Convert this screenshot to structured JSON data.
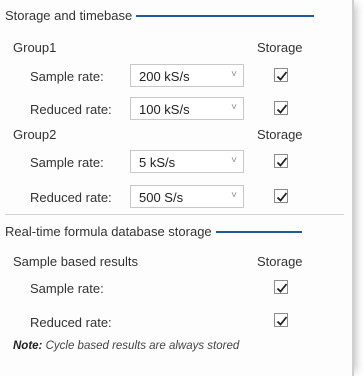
{
  "storage_section": {
    "title": "Storage and timebase",
    "groups": [
      {
        "label": "Group1",
        "storage_header": "Storage",
        "sample_label": "Sample rate:",
        "sample_value": "200 kS/s",
        "sample_checked": true,
        "reduced_label": "Reduced rate:",
        "reduced_value": "100 kS/s",
        "reduced_checked": true
      },
      {
        "label": "Group2",
        "storage_header": "Storage",
        "sample_label": "Sample rate:",
        "sample_value": "5 kS/s",
        "sample_checked": true,
        "reduced_label": "Reduced rate:",
        "reduced_value": "500 S/s",
        "reduced_checked": true
      }
    ]
  },
  "formula_section": {
    "title": "Real-time formula database storage",
    "subheading": "Sample based results",
    "storage_header": "Storage",
    "sample_label": "Sample rate:",
    "sample_checked": true,
    "reduced_label": "Reduced rate:",
    "reduced_checked": true,
    "note_label": "Note:",
    "note_text": "Cycle based results are always stored"
  },
  "colors": {
    "accent_rule": "#1f5a9e"
  },
  "icons": {
    "dropdown": "chevron-down-icon",
    "check": "checkmark-icon"
  }
}
